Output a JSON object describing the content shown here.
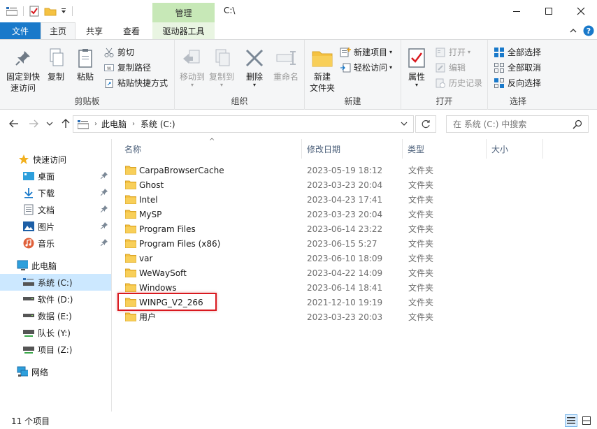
{
  "titlebar": {
    "context_tab": "管理",
    "path_title": "C:\\"
  },
  "tabs": {
    "file": "文件",
    "home": "主页",
    "share": "共享",
    "view": "查看",
    "drive_tools": "驱动器工具"
  },
  "ribbon": {
    "clipboard": {
      "label": "剪贴板",
      "pin_line1": "固定到快",
      "pin_line2": "速访问",
      "copy": "复制",
      "paste": "粘贴",
      "cut": "剪切",
      "copy_path": "复制路径",
      "paste_shortcut": "粘贴快捷方式"
    },
    "organize": {
      "label": "组织",
      "move_to": "移动到",
      "copy_to": "复制到",
      "delete": "删除",
      "rename": "重命名"
    },
    "new": {
      "label": "新建",
      "new_folder_line1": "新建",
      "new_folder_line2": "文件夹",
      "new_item": "新建项目",
      "easy_access": "轻松访问"
    },
    "open": {
      "label": "打开",
      "properties": "属性",
      "open": "打开",
      "edit": "编辑",
      "history": "历史记录"
    },
    "select": {
      "label": "选择",
      "select_all": "全部选择",
      "select_none": "全部取消",
      "invert": "反向选择"
    }
  },
  "address": {
    "breadcrumb_root": "此电脑",
    "breadcrumb_current": "系统 (C:)",
    "search_placeholder": "在 系统 (C:) 中搜索"
  },
  "sidebar": {
    "quick_access": "快速访问",
    "quick_items": [
      "桌面",
      "下载",
      "文档",
      "图片",
      "音乐"
    ],
    "this_pc": "此电脑",
    "drives": [
      "系统 (C:)",
      "软件 (D:)",
      "数据 (E:)",
      "队长 (Y:)",
      "项目 (Z:)"
    ],
    "network": "网络"
  },
  "columns": {
    "name": "名称",
    "modified": "修改日期",
    "type": "类型",
    "size": "大小"
  },
  "files": [
    {
      "name": "CarpaBrowserCache",
      "date": "2023-05-19 18:12",
      "type": "文件夹"
    },
    {
      "name": "Ghost",
      "date": "2023-03-23 20:04",
      "type": "文件夹"
    },
    {
      "name": "Intel",
      "date": "2023-04-23 17:41",
      "type": "文件夹"
    },
    {
      "name": "MySP",
      "date": "2023-03-23 20:04",
      "type": "文件夹"
    },
    {
      "name": "Program Files",
      "date": "2023-06-14 23:22",
      "type": "文件夹"
    },
    {
      "name": "Program Files (x86)",
      "date": "2023-06-15 5:27",
      "type": "文件夹"
    },
    {
      "name": "var",
      "date": "2023-06-10 18:09",
      "type": "文件夹"
    },
    {
      "name": "WeWaySoft",
      "date": "2023-04-22 14:09",
      "type": "文件夹"
    },
    {
      "name": "Windows",
      "date": "2023-06-14 18:41",
      "type": "文件夹"
    },
    {
      "name": "WINPG_V2_266",
      "date": "2021-12-10 19:19",
      "type": "文件夹"
    },
    {
      "name": "用户",
      "date": "2023-03-23 20:03",
      "type": "文件夹"
    }
  ],
  "status": {
    "count": "11 个项目"
  },
  "colors": {
    "accent": "#1979ca",
    "manage_tab": "#c7e8b7",
    "selection": "#cce8ff",
    "highlight": "#d9191f",
    "folder": "#f5c242"
  }
}
